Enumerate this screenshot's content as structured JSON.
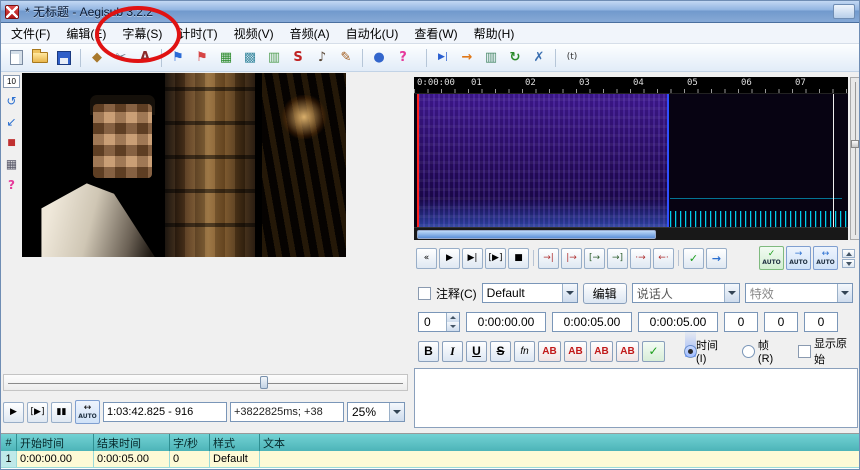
{
  "window": {
    "title": "* 无标题 - Aegisub 3.2.2"
  },
  "menu": {
    "items": [
      "文件(F)",
      "编辑(E)",
      "字幕(S)",
      "计时(T)",
      "视频(V)",
      "音频(A)",
      "自动化(U)",
      "查看(W)",
      "帮助(H)"
    ]
  },
  "toolbar": {
    "icons": [
      {
        "name": "new-file",
        "glyph": ""
      },
      {
        "name": "open-file",
        "glyph": ""
      },
      {
        "name": "save-file",
        "glyph": ""
      },
      {
        "name": "properties",
        "glyph": "◆",
        "style": "color:#a8792c"
      },
      {
        "name": "attachments",
        "glyph": "✂",
        "style": "color:#6a7686"
      },
      {
        "name": "fonts-collector",
        "glyph": "A",
        "style": "color:#8a2a2a;font-weight:bold"
      },
      {
        "name": "styling-assistant",
        "glyph": "⚑",
        "style": "color:#2b6bd6"
      },
      {
        "name": "translation-assistant",
        "glyph": "⚑",
        "style": "color:#d64545"
      },
      {
        "name": "styles-manager",
        "glyph": "▦",
        "style": "color:#2a8a2a"
      },
      {
        "name": "select-lines",
        "glyph": "▩",
        "style": "color:#3a8aa0"
      },
      {
        "name": "resample-resolution",
        "glyph": "▥",
        "style": "color:#55a055"
      },
      {
        "name": "spell-checker",
        "glyph": "S",
        "style": "color:#c02222;font-weight:bold"
      },
      {
        "name": "kanji-timer",
        "glyph": "♪",
        "style": "color:#554433"
      },
      {
        "name": "automation",
        "glyph": "✎",
        "style": "color:#a05a1a"
      },
      {
        "name": "log-window",
        "glyph": "●",
        "style": "color:#3366cc"
      },
      {
        "name": "help",
        "glyph": "?",
        "style": "color:#e6399b;font-weight:bold"
      },
      {
        "name": "jump-to",
        "glyph": "▶|",
        "style": "color:#2a5fd0;font-size:9px"
      },
      {
        "name": "shift-times",
        "glyph": "→",
        "style": "color:#e07818;font-weight:bold"
      },
      {
        "name": "select-visible-lines",
        "glyph": "▥",
        "style": "color:#4a8a6a"
      },
      {
        "name": "timing-post-processor",
        "glyph": "↻",
        "style": "color:#2a8a2a;font-weight:bold"
      },
      {
        "name": "options",
        "glyph": "✗",
        "style": "color:#3a6fb0;font-weight:bold"
      },
      {
        "name": "toggle-tags",
        "glyph": "(t)",
        "style": "color:#333;font-size:9px"
      }
    ]
  },
  "video_tools": {
    "zoom_value": "10",
    "tools": [
      {
        "name": "rotate-tool",
        "glyph": "↺",
        "style": "color:#2a6fd0"
      },
      {
        "name": "drag-tool",
        "glyph": "↙",
        "style": "color:#2a6fd0"
      },
      {
        "name": "stop-tool",
        "glyph": "■",
        "style": "color:#c03030;font-size:9px"
      },
      {
        "name": "clip-tool",
        "glyph": "▦",
        "style": "color:#556"
      },
      {
        "name": "video-help",
        "glyph": "?",
        "style": "color:#e6399b;font-weight:bold"
      }
    ]
  },
  "audio": {
    "timeline_labels": [
      "0:00:00",
      "01",
      "02",
      "03",
      "04",
      "05",
      "06",
      "07"
    ]
  },
  "audio_toolbar": {
    "buttons": [
      {
        "name": "scroll-left",
        "glyph": "«"
      },
      {
        "name": "play",
        "glyph": "▶"
      },
      {
        "name": "play-selection",
        "glyph": "▶|"
      },
      {
        "name": "play-line",
        "glyph": "[▶]"
      },
      {
        "name": "stop",
        "glyph": "■"
      },
      {
        "name": "play-before-selection",
        "glyph": "→|",
        "style": "color:#b03030"
      },
      {
        "name": "play-after-selection",
        "glyph": "|→",
        "style": "color:#b03030"
      },
      {
        "name": "play-first-500ms",
        "glyph": "[→",
        "style": "color:#306030"
      },
      {
        "name": "play-last-500ms",
        "glyph": "→]",
        "style": "color:#306030"
      },
      {
        "name": "play-500ms-before",
        "glyph": "·→",
        "style": "color:#b03030"
      },
      {
        "name": "play-500ms-after",
        "glyph": "←·",
        "style": "color:#b03030"
      },
      {
        "name": "commit",
        "glyph": "✓",
        "style": "color:#1a9e1a;font-weight:bold;font-size:11px"
      },
      {
        "name": "go-to-selection",
        "glyph": "→",
        "style": "color:#2a6fd0;font-weight:bold;font-size:11px"
      }
    ],
    "toggles": [
      {
        "name": "auto-commit",
        "glyph": "✓",
        "label": "AUTO",
        "style": "color:#1a9e1a"
      },
      {
        "name": "auto-next-line",
        "glyph": "→",
        "label": "AUTO",
        "style": "color:#2a6fd0"
      },
      {
        "name": "auto-scroll",
        "glyph": "↔",
        "label": "AUTO",
        "style": "color:#2a6fd0"
      }
    ]
  },
  "edit": {
    "comment_label": "注释(C)",
    "style_value": "Default",
    "edit_button": "编辑",
    "actor_value": "说话人",
    "effect_value": "特效",
    "layer": "0",
    "start": "0:00:00.00",
    "end": "0:00:05.00",
    "duration": "0:00:05.00",
    "margin_l": "0",
    "margin_r": "0",
    "margin_v": "0",
    "bold": "B",
    "italic": "I",
    "underline": "U",
    "strikeout": "S",
    "fn": "fn",
    "color1": "AB",
    "color2": "AB",
    "color3": "AB",
    "color4": "AB",
    "commit_glyph": "✓",
    "time_radio": "时间(I)",
    "frame_radio": "帧(R)",
    "show_original": "显示原始",
    "text_value": ""
  },
  "video_controls": {
    "play_glyph": "▶",
    "play_line_glyph": "[▶]",
    "pause_glyph": "▮▮",
    "auto_glyph": "↔",
    "auto_label": "AUTO",
    "position_text": "1:03:42.825 - 916",
    "offset_text": "+3822825ms; +38",
    "zoom_value": "25%"
  },
  "grid": {
    "columns": [
      "#",
      "开始时间",
      "结束时间",
      "字/秒",
      "样式",
      "文本"
    ],
    "rows": [
      [
        "1",
        "0:00:00.00",
        "0:00:05.00",
        "0",
        "Default",
        ""
      ]
    ]
  },
  "annotation": {
    "shape": "ellipse-highlight",
    "color": "#e01212"
  },
  "colors": {
    "titlebar": "#8fb3e0",
    "grid_header": "#4db4b8",
    "selected_row": "#fdfad6",
    "spectrogram_selection": "#2c0f6e",
    "selection_end_marker": "#3050ff",
    "selection_start_marker": "#ff2020"
  }
}
